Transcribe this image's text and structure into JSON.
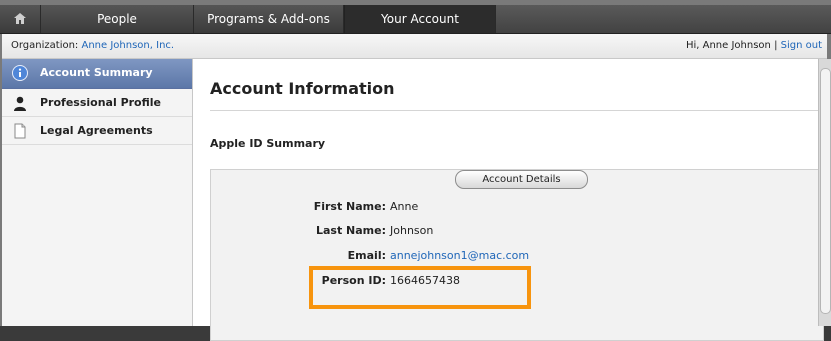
{
  "topnav": {
    "tabs": [
      {
        "label": "People"
      },
      {
        "label": "Programs & Add-ons"
      },
      {
        "label": "Your Account"
      }
    ]
  },
  "orgbar": {
    "org_label": "Organization:",
    "org_name": "Anne Johnson, Inc.",
    "greeting": "Hi, Anne Johnson",
    "separator": "|",
    "signout": "Sign out"
  },
  "sidebar": {
    "items": [
      {
        "label": "Account Summary",
        "icon": "info-icon",
        "active": true
      },
      {
        "label": "Professional Profile",
        "icon": "person-icon"
      },
      {
        "label": "Legal Agreements",
        "icon": "document-icon"
      }
    ]
  },
  "main": {
    "title": "Account Information",
    "section_title": "Apple ID Summary",
    "fields": {
      "first_name_label": "First Name:",
      "first_name": "Anne",
      "last_name_label": "Last Name:",
      "last_name": "Johnson",
      "email_label": "Email:",
      "email": "annejohnson1@mac.com",
      "person_id_label": "Person ID:",
      "person_id": "1664657438"
    },
    "details_button": "Account Details"
  },
  "colors": {
    "highlight": "#f7940e",
    "link": "#1f66b8",
    "active_sidebar": "#6b84b5"
  }
}
